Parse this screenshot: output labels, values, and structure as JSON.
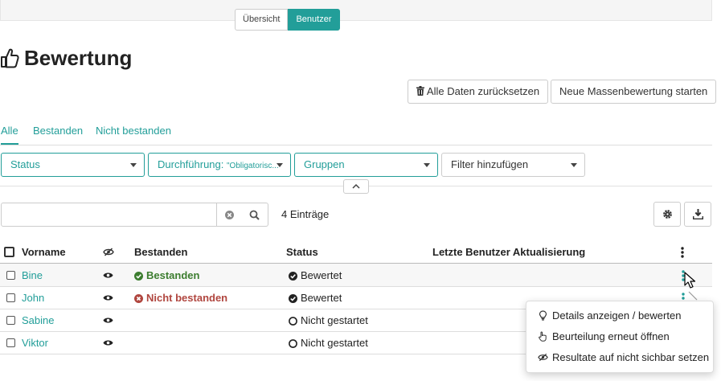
{
  "segmented": {
    "overview": "Übersicht",
    "users": "Benutzer"
  },
  "page": {
    "title": "Bewertung"
  },
  "actions": {
    "reset_all": "Alle Daten zurücksetzen",
    "mass_assessment": "Neue Massenbewertung starten"
  },
  "tabs": [
    {
      "label": "Alle",
      "active": true
    },
    {
      "label": "Bestanden",
      "active": false
    },
    {
      "label": "Nicht bestanden",
      "active": false
    }
  ],
  "filters": {
    "status": "Status",
    "execution_label": "Durchführung: ",
    "execution_value": "\"Obligatorisc...",
    "groups": "Gruppen",
    "add_filter": "Filter hinzufügen"
  },
  "search": {
    "value": "",
    "placeholder": "",
    "entries": "4 Einträge"
  },
  "table": {
    "columns": {
      "firstname": "Vorname",
      "passed": "Bestanden",
      "status": "Status",
      "last_update": "Letzte Benutzer Aktualisierung"
    },
    "rows": [
      {
        "firstname": "Bine",
        "passed": "Bestanden",
        "passed_state": "passed",
        "status": "Bewertet",
        "status_state": "done"
      },
      {
        "firstname": "John",
        "passed": "Nicht bestanden",
        "passed_state": "failed",
        "status": "Bewertet",
        "status_state": "done"
      },
      {
        "firstname": "Sabine",
        "passed": "",
        "passed_state": "none",
        "status": "Nicht gestartet",
        "status_state": "notstarted"
      },
      {
        "firstname": "Viktor",
        "passed": "",
        "passed_state": "none",
        "status": "Nicht gestartet",
        "status_state": "notstarted"
      }
    ]
  },
  "row_menu": {
    "details": "Details anzeigen / bewerten",
    "reopen": "Beurteilung erneut öffnen",
    "hide_results": "Resultate auf nicht sichbar setzen"
  },
  "colors": {
    "accent": "#229e99",
    "passed": "#3c7d2f",
    "failed": "#b0463f"
  }
}
